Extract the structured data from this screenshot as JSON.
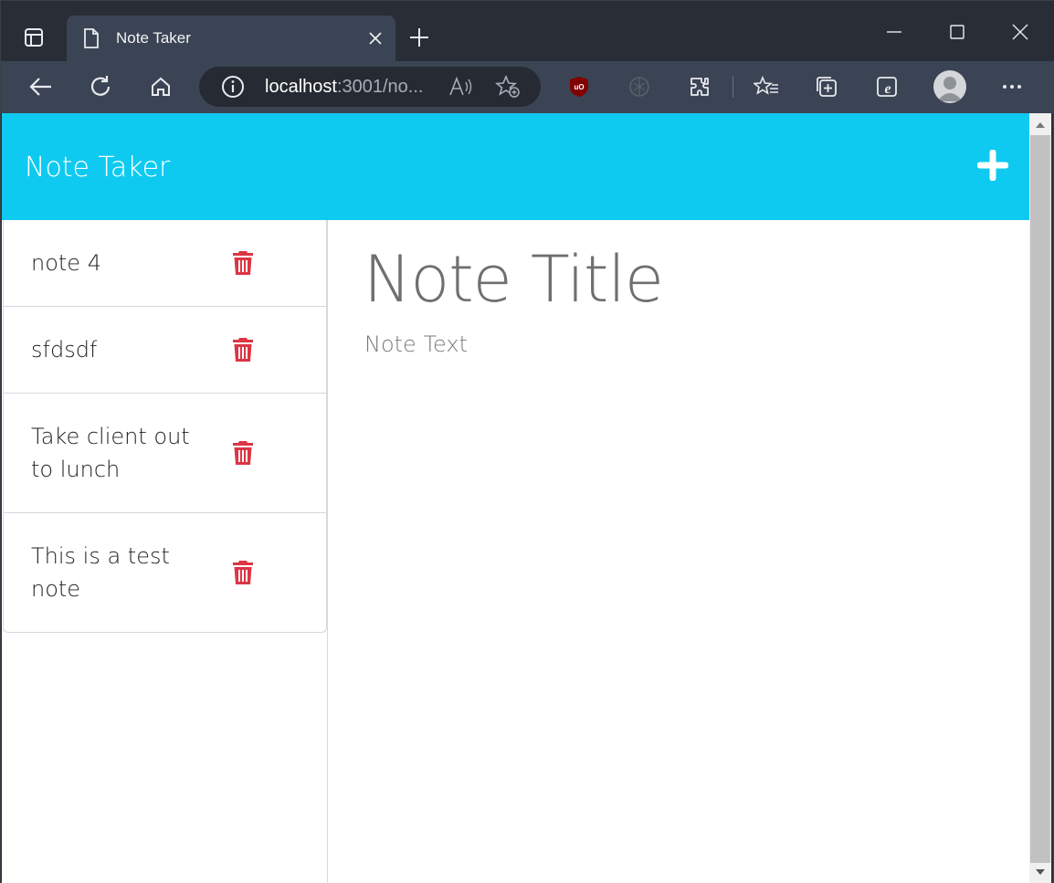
{
  "browser": {
    "tab_title": "Note Taker",
    "url_host": "localhost",
    "url_rest": ":3001/no...",
    "icons": [
      "tab-actions-icon",
      "page-icon",
      "close-icon",
      "new-tab-icon",
      "minimize-icon",
      "maximize-icon",
      "window-close-icon",
      "back-icon",
      "refresh-icon",
      "home-icon",
      "info-icon",
      "read-aloud-icon",
      "add-favorite-icon",
      "ublock-icon",
      "extension-icon",
      "extensions-icon",
      "favorites-icon",
      "collections-icon",
      "ie-mode-icon",
      "profile-icon",
      "more-icon"
    ]
  },
  "app": {
    "brand": "Note Taker",
    "accent_color": "#0ecaf0",
    "delete_color": "#dc3545"
  },
  "notes": [
    {
      "title": "note 4"
    },
    {
      "title": "sfdsdf"
    },
    {
      "title": "Take client out to lunch"
    },
    {
      "title": "This is a test note"
    }
  ],
  "editor": {
    "title_placeholder": "Note Title",
    "text_placeholder": "Note Text"
  }
}
